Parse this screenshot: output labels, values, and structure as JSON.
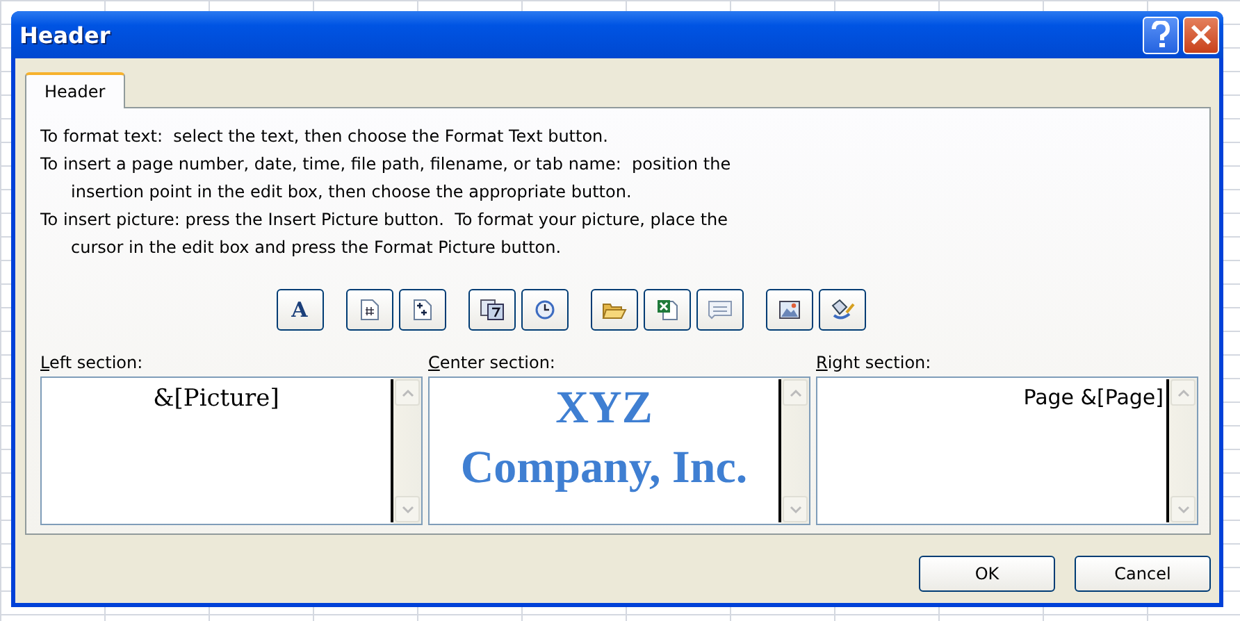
{
  "window": {
    "title": "Header"
  },
  "tabs": [
    {
      "label": "Header",
      "selected": true
    }
  ],
  "instructions": [
    {
      "lines": [
        "To format text:  select the text, then choose the Format Text button."
      ]
    },
    {
      "lines": [
        "To insert a page number, date, time, file path, filename, or tab name:  position the",
        "insertion point in the edit box, then choose the appropriate button."
      ]
    },
    {
      "lines": [
        "To insert picture: press the Insert Picture button.  To format your picture, place the",
        "cursor in the edit box and press the Format Picture button."
      ]
    }
  ],
  "toolbar": [
    [
      {
        "kind": "format_text",
        "glyph": "A"
      }
    ],
    [
      {
        "kind": "page_number"
      },
      {
        "kind": "page_count"
      }
    ],
    [
      {
        "kind": "date"
      },
      {
        "kind": "time"
      }
    ],
    [
      {
        "kind": "file_path"
      },
      {
        "kind": "filename"
      },
      {
        "kind": "sheet_name"
      }
    ],
    [
      {
        "kind": "picture"
      },
      {
        "kind": "format_picture"
      }
    ]
  ],
  "sections": [
    {
      "label": "Left section:",
      "value_lines": [
        "&[Picture]"
      ]
    },
    {
      "label": "Center section:",
      "value_lines": [
        "XYZ",
        "Company, Inc."
      ]
    },
    {
      "label": "Right section:",
      "value_lines": [
        "Page &[Page]"
      ]
    }
  ],
  "buttons": [
    {
      "label": "OK"
    },
    {
      "label": "Cancel"
    }
  ]
}
